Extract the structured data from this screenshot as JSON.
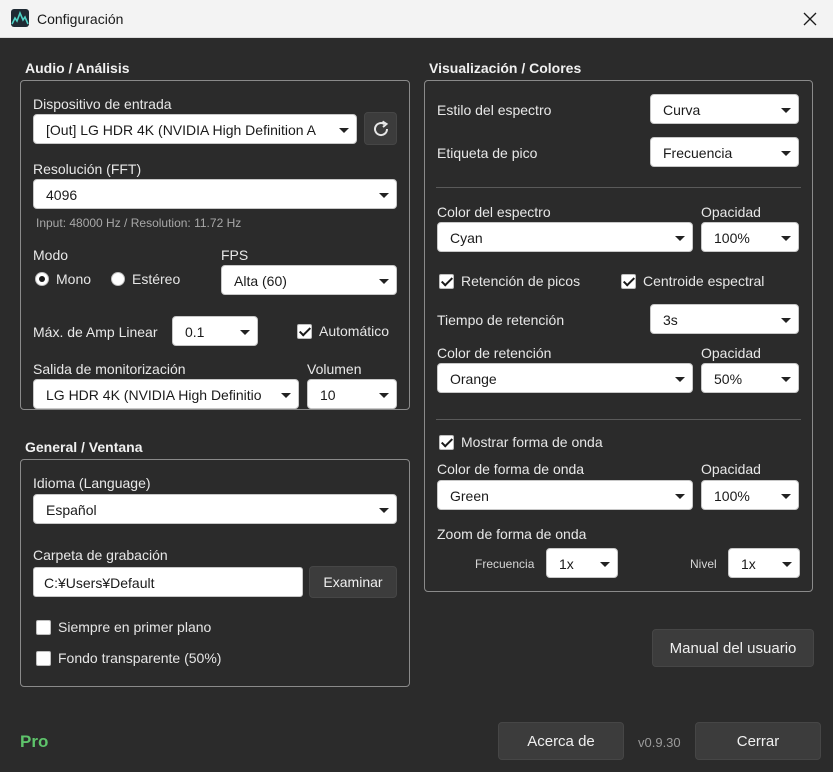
{
  "window": {
    "title": "Configuración",
    "close_icon": "close-icon"
  },
  "audio": {
    "section_title": "Audio / Análisis",
    "input_device_label": "Dispositivo de entrada",
    "input_device_value": "[Out] LG HDR 4K (NVIDIA High Definition A",
    "refresh_icon": "refresh-icon",
    "fft_label": "Resolución (FFT)",
    "fft_value": "4096",
    "info_text": "Input: 48000 Hz / Resolution: 11.72 Hz",
    "mode_label": "Modo",
    "mode_mono": "Mono",
    "mode_stereo": "Estéreo",
    "fps_label": "FPS",
    "fps_value": "Alta (60)",
    "amp_label": "Máx. de Amp Linear",
    "amp_value": "0.1",
    "auto_label": "Automático",
    "monitor_label": "Salida de monitorización",
    "monitor_value": "LG HDR 4K (NVIDIA High Definitio",
    "volume_label": "Volumen",
    "volume_value": "10"
  },
  "general": {
    "section_title": "General / Ventana",
    "language_label": "Idioma (Language)",
    "language_value": "Español",
    "folder_label": "Carpeta de grabación",
    "folder_value": "C:¥Users¥Default",
    "browse_label": "Examinar",
    "always_on_top": "Siempre en primer plano",
    "transparent_bg": "Fondo transparente (50%)"
  },
  "visual": {
    "section_title": "Visualización / Colores",
    "spectrum_style_label": "Estilo del espectro",
    "spectrum_style_value": "Curva",
    "peak_label_label": "Etiqueta de pico",
    "peak_label_value": "Frecuencia",
    "spectrum_color_label": "Color del espectro",
    "spectrum_color_value": "Cyan",
    "opacity_label": "Opacidad",
    "spectrum_opacity_value": "100%",
    "peak_hold_label": "Retención de picos",
    "centroid_label": "Centroide espectral",
    "hold_time_label": "Tiempo de retención",
    "hold_time_value": "3s",
    "hold_color_label": "Color de retención",
    "hold_color_value": "Orange",
    "hold_opacity_value": "50%",
    "show_waveform_label": "Mostrar forma de onda",
    "waveform_color_label": "Color de forma de onda",
    "waveform_color_value": "Green",
    "waveform_opacity_value": "100%",
    "waveform_zoom_label": "Zoom de forma de onda",
    "freq_label": "Frecuencia",
    "freq_zoom_value": "1x",
    "level_label": "Nivel",
    "level_zoom_value": "1x"
  },
  "footer": {
    "manual_label": "Manual del usuario",
    "pro_label": "Pro",
    "about_label": "Acerca de",
    "version": "v0.9.30",
    "close_label": "Cerrar"
  },
  "colors": {
    "pro_green": "#5ec46b",
    "background": "#2b2b2b"
  }
}
